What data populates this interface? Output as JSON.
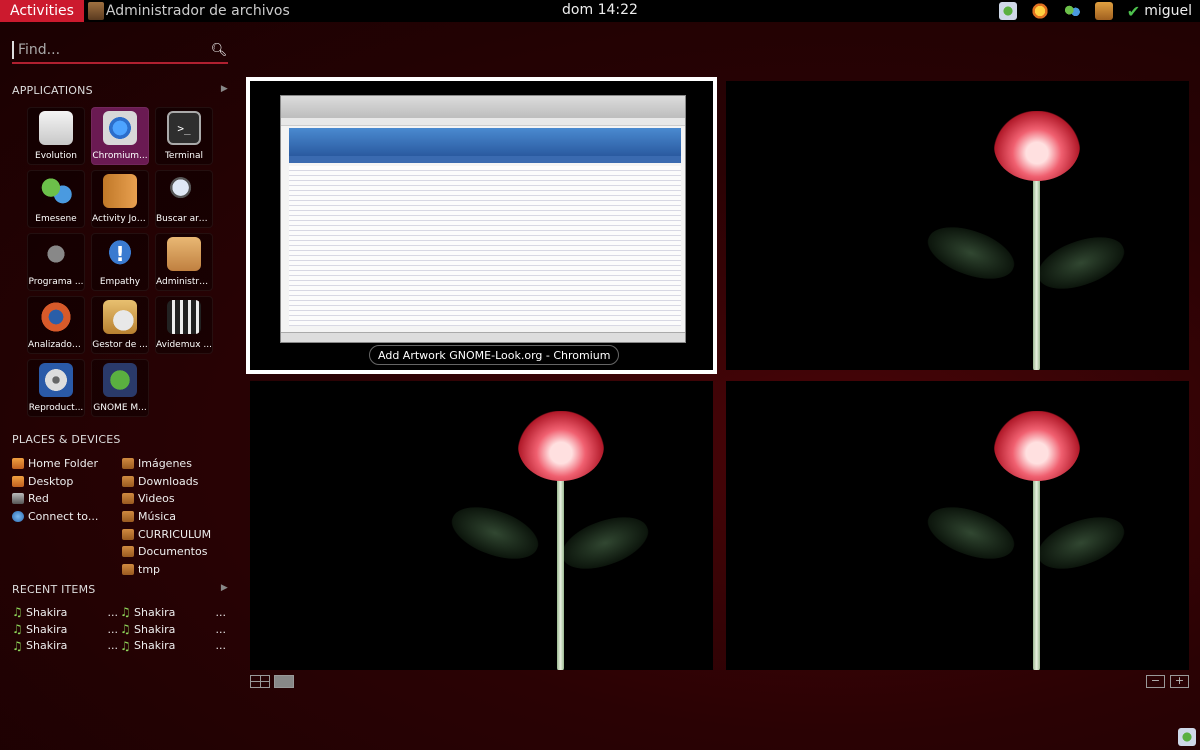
{
  "top_panel": {
    "activities_label": "Activities",
    "app_name": "Administrador de archivos",
    "clock": "dom 14:22",
    "user": "miguel"
  },
  "search": {
    "placeholder": "Find..."
  },
  "applications": {
    "title": "APPLICATIONS",
    "items": [
      {
        "label": "Evolution",
        "icon": "evolution-mail-icon"
      },
      {
        "label": "Chromium...",
        "icon": "chromium-icon"
      },
      {
        "label": "Terminal",
        "icon": "terminal-icon"
      },
      {
        "label": "Emesene",
        "icon": "emesene-icon"
      },
      {
        "label": "Activity Jou...",
        "icon": "activity-journal-icon"
      },
      {
        "label": "Buscar arc...",
        "icon": "search-files-icon"
      },
      {
        "label": "Programa ...",
        "icon": "gimp-icon"
      },
      {
        "label": "Empathy",
        "icon": "empathy-icon"
      },
      {
        "label": "Administra...",
        "icon": "file-cabinet-icon"
      },
      {
        "label": "Analizador ...",
        "icon": "disk-analyzer-icon"
      },
      {
        "label": "Gestor de ...",
        "icon": "package-manager-icon"
      },
      {
        "label": "Avidemux ...",
        "icon": "avidemux-icon"
      },
      {
        "label": "Reproduct...",
        "icon": "media-player-icon"
      },
      {
        "label": "GNOME M...",
        "icon": "gnome-mplayer-icon"
      }
    ]
  },
  "places": {
    "title": "PLACES & DEVICES",
    "left": [
      "Home Folder",
      "Desktop",
      "Red",
      "Connect to..."
    ],
    "right": [
      "Imágenes",
      "Downloads",
      "Videos",
      "Música",
      "CURRICULUM",
      "Documentos",
      "tmp"
    ]
  },
  "recent": {
    "title": "RECENT ITEMS",
    "items": [
      "Shakira",
      "Shakira",
      "Shakira",
      "Shakira",
      "Shakira",
      "Shakira"
    ],
    "ellipsis": "..."
  },
  "workspaces": {
    "window_caption": "Add  Artwork GNOME-Look.org - Chromium"
  },
  "zoom": {
    "minus": "−",
    "plus": "+"
  },
  "colors": {
    "accent": "#cc1a2e",
    "background": "#2a0204",
    "selected_app": "#6a1a52"
  }
}
